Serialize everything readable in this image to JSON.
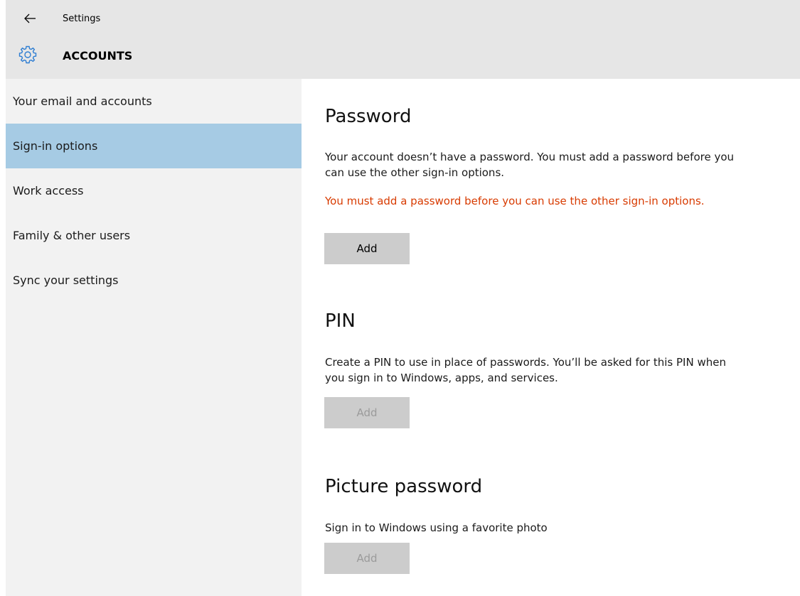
{
  "header": {
    "back_icon": "back-arrow-icon",
    "app_title": "Settings",
    "section_icon": "gear-icon",
    "section_title": "ACCOUNTS",
    "accent_color": "#2d7dd2"
  },
  "sidebar": {
    "items": [
      {
        "label": "Your email and accounts",
        "selected": false
      },
      {
        "label": "Sign-in options",
        "selected": true
      },
      {
        "label": "Work access",
        "selected": false
      },
      {
        "label": "Family & other users",
        "selected": false
      },
      {
        "label": "Sync your settings",
        "selected": false
      }
    ],
    "selected_color": "#a6cbe4"
  },
  "main": {
    "password": {
      "heading": "Password",
      "description": "Your account doesn’t have a password. You must add a password before you can use the other sign-in options.",
      "warning": "You must add a password before you can use the other sign-in options.",
      "warning_color": "#d83b01",
      "button_label": "Add",
      "button_enabled": true
    },
    "pin": {
      "heading": "PIN",
      "description": "Create a PIN to use in place of passwords. You’ll be asked for this PIN when you sign in to Windows, apps, and services.",
      "button_label": "Add",
      "button_enabled": false
    },
    "picture_password": {
      "heading": "Picture password",
      "description": "Sign in to Windows using a favorite photo",
      "button_label": "Add",
      "button_enabled": false
    }
  }
}
